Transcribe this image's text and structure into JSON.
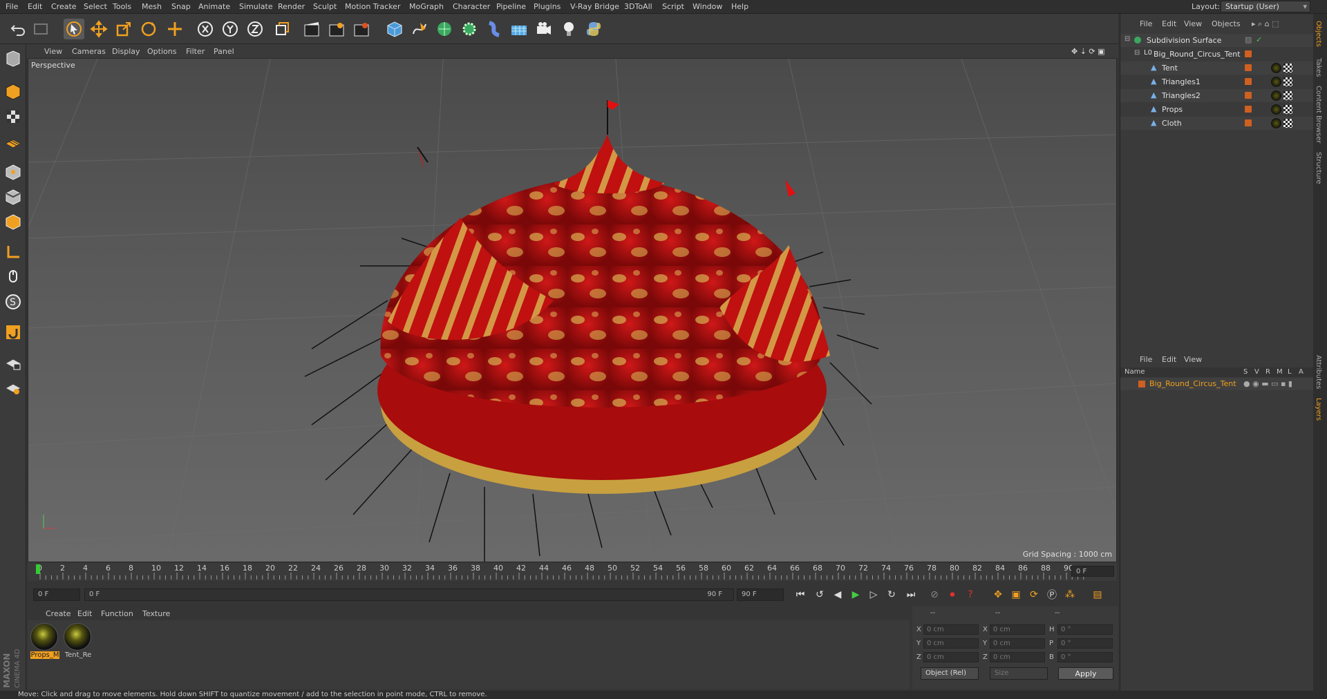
{
  "menubar": {
    "items": [
      "File",
      "Edit",
      "Create",
      "Select",
      "Tools",
      "Mesh",
      "Snap",
      "Animate",
      "Simulate",
      "Render",
      "Sculpt",
      "Motion Tracker",
      "MoGraph",
      "Character",
      "Pipeline",
      "Plugins",
      "V-Ray Bridge",
      "3DToAll",
      "Script",
      "Window",
      "Help"
    ],
    "layout_label": "Layout:",
    "layout_value": "Startup (User)"
  },
  "toolbar": {
    "icons": [
      "undo-icon",
      "redo-icon",
      "live-selection-icon",
      "move-icon",
      "scale-icon",
      "rotate-icon",
      "recent-tool-icon",
      "x-axis-icon",
      "y-axis-icon",
      "z-axis-icon",
      "world-coords-icon",
      "render-view-icon",
      "render-picture-viewer-icon",
      "edit-render-settings-icon",
      "cube-icon",
      "pen-spline-icon",
      "subdivision-icon",
      "cloner-icon",
      "deformer-icon",
      "floor-icon",
      "camera-icon",
      "light-icon",
      "python-icon"
    ]
  },
  "viewport": {
    "menu": [
      "View",
      "Cameras",
      "Display",
      "Options",
      "Filter",
      "Panel"
    ],
    "label": "Perspective",
    "grid_spacing": "Grid Spacing : 1000 cm"
  },
  "timeline": {
    "ticks": [
      "0",
      "2",
      "4",
      "6",
      "8",
      "10",
      "12",
      "14",
      "16",
      "18",
      "20",
      "22",
      "24",
      "26",
      "28",
      "30",
      "32",
      "34",
      "36",
      "38",
      "40",
      "42",
      "44",
      "46",
      "48",
      "50",
      "52",
      "54",
      "56",
      "58",
      "60",
      "62",
      "64",
      "66",
      "68",
      "70",
      "72",
      "74",
      "76",
      "78",
      "80",
      "82",
      "84",
      "86",
      "88",
      "90"
    ],
    "current_frame": "0 F",
    "start_field": "0 F",
    "range_start": "0 F",
    "range_end": "90 F",
    "end_field": "90 F"
  },
  "materials": {
    "menu": [
      "Create",
      "Edit",
      "Function",
      "Texture"
    ],
    "items": [
      {
        "label": "Props_M",
        "active": true
      },
      {
        "label": "Tent_Re",
        "active": false
      }
    ]
  },
  "coordinates": {
    "header_dashes": [
      "--",
      "--",
      "--"
    ],
    "rows": [
      {
        "a": "X",
        "av": "0 cm",
        "b": "X",
        "bv": "0 cm",
        "c": "H",
        "cv": "0 °"
      },
      {
        "a": "Y",
        "av": "0 cm",
        "b": "Y",
        "bv": "0 cm",
        "c": "P",
        "cv": "0 °"
      },
      {
        "a": "Z",
        "av": "0 cm",
        "b": "Z",
        "bv": "0 cm",
        "c": "B",
        "cv": "0 °"
      }
    ],
    "mode": "Object (Rel)",
    "size": "Size",
    "apply": "Apply"
  },
  "objects_panel": {
    "menu": [
      "File",
      "Edit",
      "View",
      "Objects"
    ],
    "tree": [
      {
        "label": "Subdivision Surface",
        "level": 0
      },
      {
        "label": "Big_Round_Circus_Tent",
        "level": 1
      },
      {
        "label": "Tent",
        "level": 2
      },
      {
        "label": "Triangles1",
        "level": 2
      },
      {
        "label": "Triangles2",
        "level": 2
      },
      {
        "label": "Props",
        "level": 2
      },
      {
        "label": "Cloth",
        "level": 2
      }
    ]
  },
  "layers_panel": {
    "menu": [
      "File",
      "Edit",
      "View"
    ],
    "columns": [
      "Name",
      "S",
      "V",
      "R",
      "M",
      "L",
      "A"
    ],
    "row_label": "Big_Round_Circus_Tent"
  },
  "side_tabs": [
    "Objects",
    "Takes",
    "Content Browser",
    "Structure",
    "Attributes",
    "Layers"
  ],
  "status": "Move: Click and drag to move elements. Hold down SHIFT to quantize movement / add to the selection in point mode, CTRL to remove.",
  "brand": "MAXON CINEMA 4D",
  "colors": {
    "accent": "#f0a020",
    "tent_red": "#c81010",
    "tent_gold": "#d8b850"
  }
}
